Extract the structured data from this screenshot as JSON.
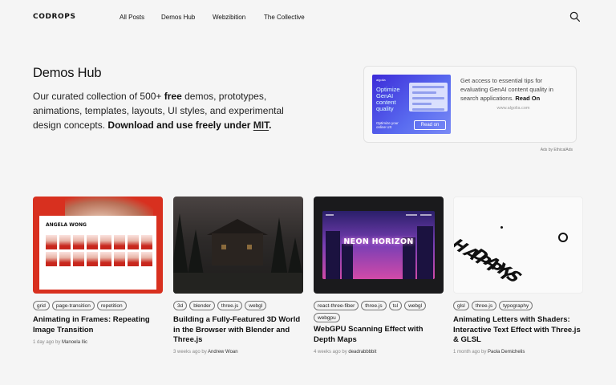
{
  "header": {
    "logo": "CODROPS",
    "nav": [
      "All Posts",
      "Demos Hub",
      "Webzibition",
      "The Collective"
    ]
  },
  "hero": {
    "title": "Demos Hub",
    "desc_prefix": "Our curated collection of 500+ ",
    "desc_free": "free",
    "desc_middle": " demos, prototypes, animations, templates, layouts, UI styles, and experimental design concepts. ",
    "desc_download": "Download and use freely under ",
    "desc_mit": "MIT",
    "desc_end": "."
  },
  "ad": {
    "img_brand": "algolia",
    "img_headline": "Optimize GenAI content quality",
    "img_sub": "Optimize your online UX",
    "img_button": "Read on",
    "text": "Get access to essential tips for evaluating GenAI content quality in search applications. ",
    "read_on": "Read On",
    "url": "www.algolia.com",
    "credit": "Ads by EthicalAds"
  },
  "cards": [
    {
      "thumb_text": "ANGELA WONG",
      "tags": [
        "grid",
        "page-transition",
        "repetition"
      ],
      "title": "Animating in Frames: Repeating Image Transition",
      "time": "1 day ago by ",
      "author": "Manoela Ilic"
    },
    {
      "tags": [
        "3d",
        "blender",
        "three.js",
        "webgl"
      ],
      "title": "Building a Fully-Featured 3D World in the Browser with Blender and Three.js",
      "time": "3 weeks ago by ",
      "author": "Andrew Woan"
    },
    {
      "thumb_text": "NEON HORIZON",
      "tags": [
        "react-three-fiber",
        "three.js",
        "tsl",
        "webgl",
        "webgpu"
      ],
      "title": "WebGPU Scanning Effect with Depth Maps",
      "time": "4 weeks ago by ",
      "author": "deadrabbbbit"
    },
    {
      "thumb_text_1": "HAPPY",
      "thumb_text_2": "DAYS",
      "tags": [
        "glsl",
        "three.js",
        "typography"
      ],
      "title": "Animating Letters with Shaders: Interactive Text Effect with Three.js & GLSL",
      "time": "1 month ago by ",
      "author": "Paola Demichelis"
    }
  ]
}
